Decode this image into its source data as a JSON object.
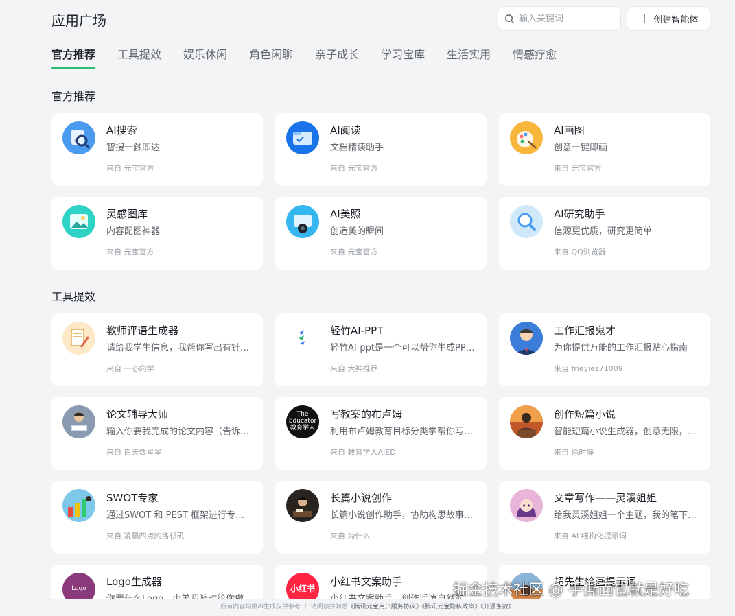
{
  "header": {
    "title": "应用广场",
    "search_placeholder": "输入关键词",
    "create_label": "创建智能体"
  },
  "tabs": [
    {
      "label": "官方推荐",
      "active": true
    },
    {
      "label": "工具提效",
      "active": false
    },
    {
      "label": "娱乐休闲",
      "active": false
    },
    {
      "label": "角色闲聊",
      "active": false
    },
    {
      "label": "亲子成长",
      "active": false
    },
    {
      "label": "学习宝库",
      "active": false
    },
    {
      "label": "生活实用",
      "active": false
    },
    {
      "label": "情感疗愈",
      "active": false
    }
  ],
  "sections": {
    "official": {
      "title": "官方推荐",
      "cards": [
        {
          "name": "AI搜索",
          "desc": "智搜一触即达",
          "source": "来自 元宝官方",
          "icon": "magnifier-doc-icon"
        },
        {
          "name": "AI阅读",
          "desc": "文档精读助手",
          "source": "来自 元宝官方",
          "icon": "folder-read-icon"
        },
        {
          "name": "AI画图",
          "desc": "创意一键即画",
          "source": "来自 元宝官方",
          "icon": "palette-brush-icon"
        },
        {
          "name": "灵感图库",
          "desc": "内容配图神器",
          "source": "来自 元宝官方",
          "icon": "image-gallery-icon"
        },
        {
          "name": "AI美照",
          "desc": "创造美的瞬间",
          "source": "来自 元宝官方",
          "icon": "camera-photo-icon"
        },
        {
          "name": "AI研究助手",
          "desc": "信源更优质，研究更简单",
          "source": "来自 QQ浏览器",
          "icon": "research-magnifier-icon"
        }
      ]
    },
    "tools": {
      "title": "工具提效",
      "cards": [
        {
          "name": "教师评语生成器",
          "desc": "请给我学生信息，我帮你写出有针对性的评语",
          "source": "来自 一心向学",
          "icon": "notepad-pencil-icon"
        },
        {
          "name": "轻竹AI-PPT",
          "desc": "轻竹AI-ppt是一个可以帮你生成PPT的助手",
          "source": "来自 大神推荐",
          "icon": "bamboo-logo-icon"
        },
        {
          "name": "工作汇报鬼才",
          "desc": "为你提供万能的工作汇报贴心指南",
          "source": "来自 frieyies71009",
          "icon": "businessman-avatar-icon"
        },
        {
          "name": "论文辅导大师",
          "desc": "输入你要我完成的论文内容（告诉我题目）",
          "source": "来自 白天数星星",
          "icon": "student-reading-icon"
        },
        {
          "name": "写教案的布卢姆",
          "desc": "利用布卢姆教育目标分类学帮你写教案",
          "source": "来自 教育学人AIED",
          "icon": "educator-logo-icon",
          "logo_line1": "The",
          "logo_line2": "Educator",
          "logo_line3": "教育学人"
        },
        {
          "name": "创作短篇小说",
          "desc": "智能短篇小说生成器，创意无限，一键成文",
          "source": "来自 徐时廉",
          "icon": "writer-sunset-icon"
        },
        {
          "name": "SWOT专家",
          "desc": "通过SWOT 和 PEST 框架进行专业分析",
          "source": "来自 凌晨四点的洛杉矶",
          "icon": "business-chart-icon"
        },
        {
          "name": "长篇小说创作",
          "desc": "长篇小说创作助手，协助构思故事情节",
          "source": "来自 为什么",
          "icon": "novelist-desk-icon"
        },
        {
          "name": "文章写作——灵溪姐姐",
          "desc": "给我灵溪姐姐一个主题，我的笔下生花",
          "source": "来自 AI 结构化提示词",
          "icon": "anime-girl-icon"
        },
        {
          "name": "Logo生成器",
          "desc": "你要什么Logo，小弟我随时给你做",
          "source": "",
          "icon": "logo-text-icon",
          "logo_text": "Logo"
        },
        {
          "name": "小红书文案助手",
          "desc": "小红书文案助手，创作活泼自然的种草文案",
          "source": "",
          "icon": "xiaohongshu-logo-icon",
          "logo_text": "小红书"
        },
        {
          "name": "超先生绘画提示词",
          "desc": "",
          "source": "",
          "icon": "painting-prompt-icon"
        }
      ]
    }
  },
  "footer": {
    "notice": "所有内容均由AI生成仅供参考 ｜ 请阅读并知悉",
    "link1": "《腾讯元宝用户服务协议》",
    "link2": "《腾讯元宝隐私政策》",
    "link3": "《开源条款》"
  },
  "watermark": "掘金技术社区 @ 手撕面包就是好吃",
  "colors": {
    "accent": "#2dbb74",
    "background": "#f3f4f5",
    "card": "#ffffff"
  }
}
